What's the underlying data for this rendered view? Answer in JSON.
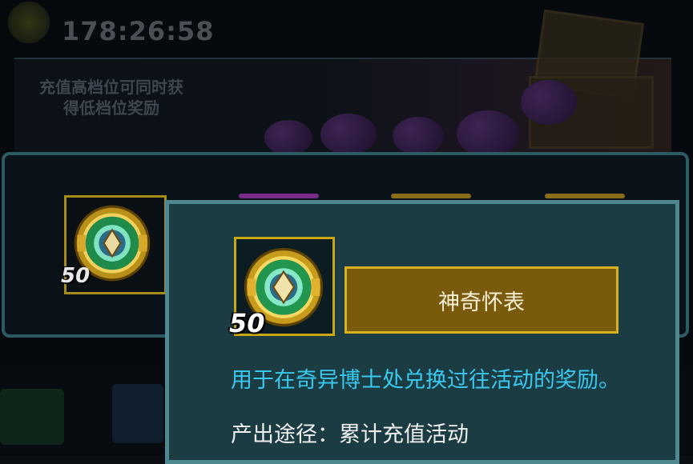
{
  "header": {
    "timer": "178:26:58",
    "icon": "alarm-clock-icon"
  },
  "banner": {
    "note": "充值高档位可同时获得低档位奖励"
  },
  "rewards": {
    "first_item_quantity": "50",
    "first_item_icon": "magic-pocket-watch-icon"
  },
  "tooltip": {
    "item_quantity": "50",
    "item_icon": "magic-pocket-watch-icon",
    "item_name": "神奇怀表",
    "description": "用于在奇异博士处兑换过往活动的奖励。",
    "source": "产出途径：累计充值活动"
  },
  "colors": {
    "tooltip_bg": "#1b3c43",
    "tooltip_border": "#4f898f",
    "name_plate": "#7a5a0c",
    "gold_frame": "#c9a814",
    "description_text": "#3ac8ee"
  }
}
